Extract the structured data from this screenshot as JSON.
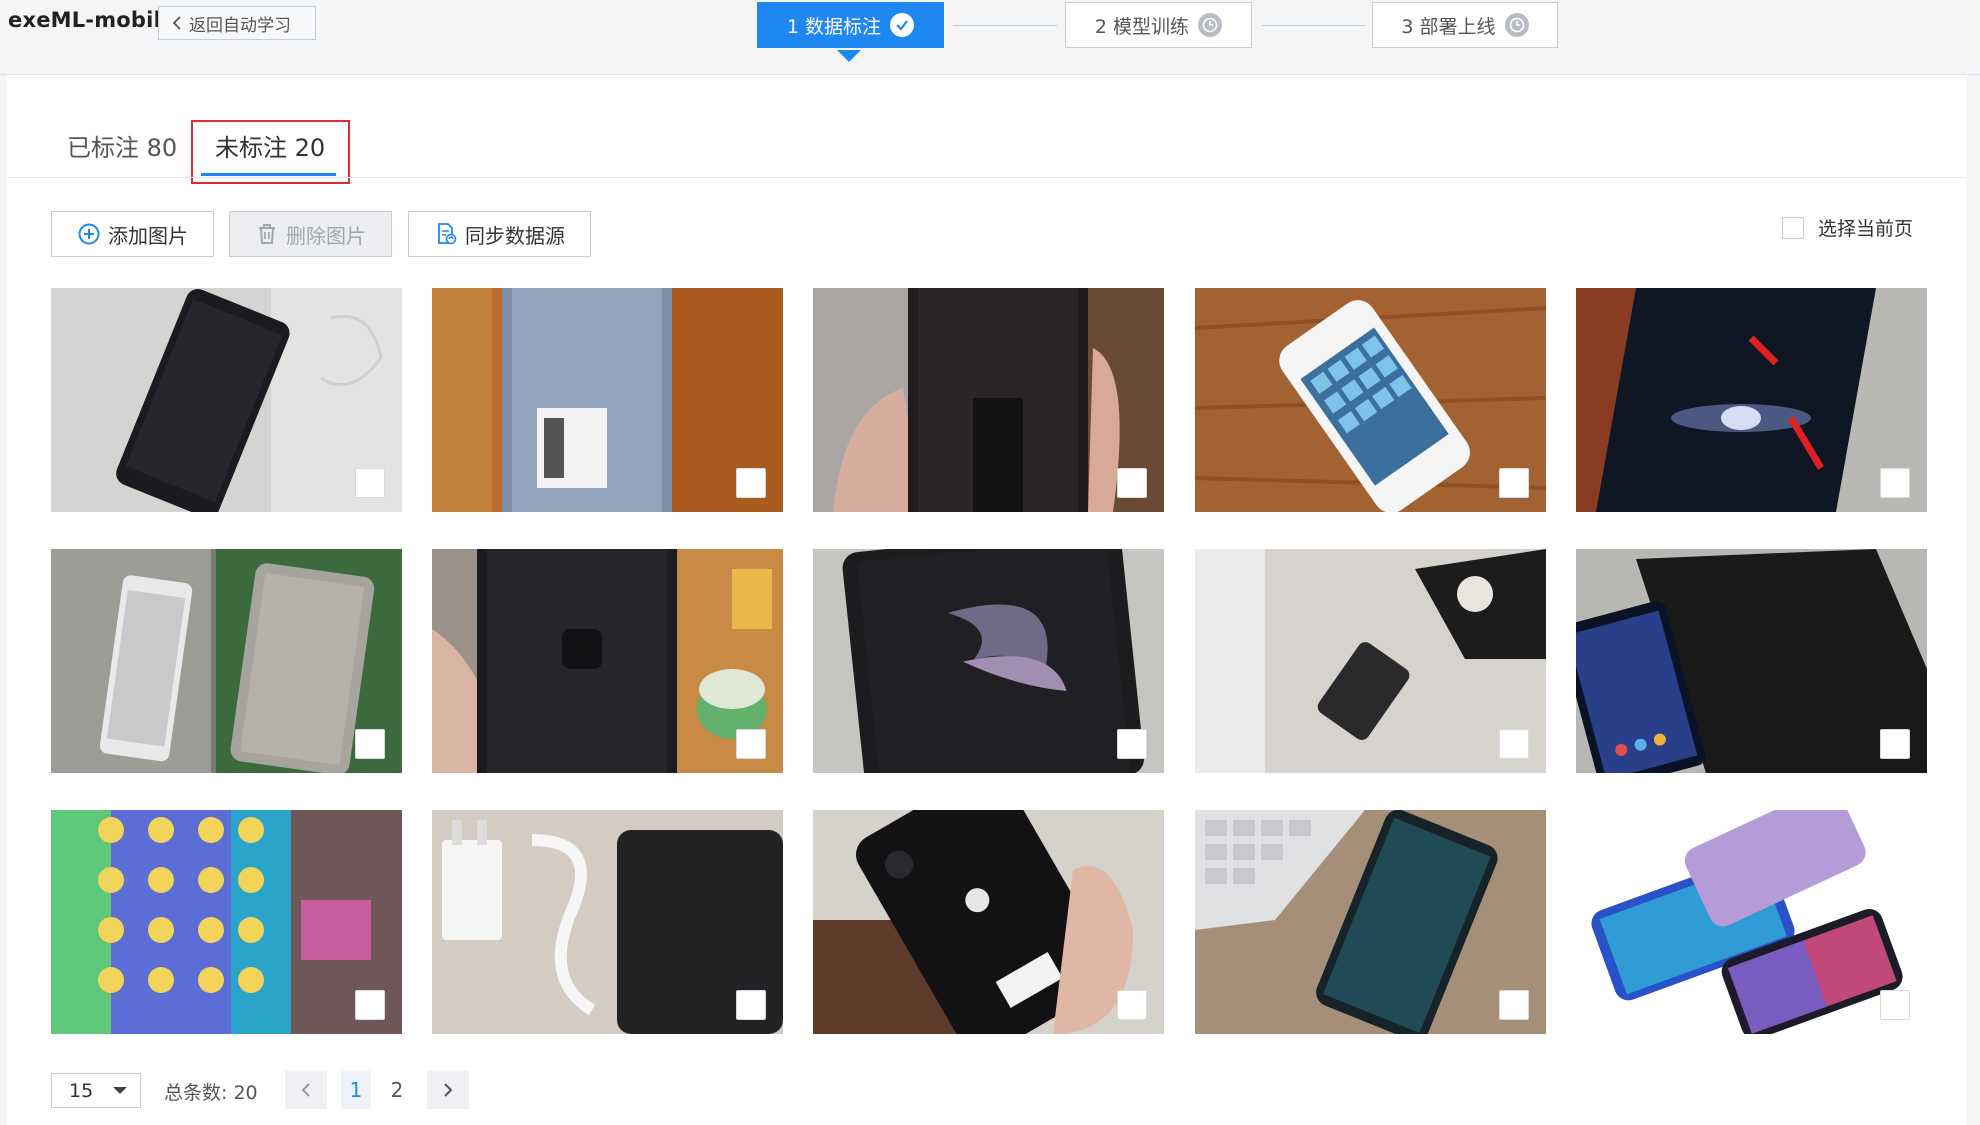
{
  "app": {
    "title": "exeML-mobil",
    "back_label": "返回自动学习"
  },
  "steps": [
    {
      "label": "1 数据标注",
      "state": "done"
    },
    {
      "label": "2 模型训练",
      "state": "pending"
    },
    {
      "label": "3 部署上线",
      "state": "pending"
    }
  ],
  "tabs": [
    {
      "label": "已标注 80"
    },
    {
      "label": "未标注 20"
    }
  ],
  "active_tab": 1,
  "toolbar": {
    "add_label": "添加图片",
    "delete_label": "删除图片",
    "sync_label": "同步数据源",
    "select_page_label": "选择当前页"
  },
  "images": [
    {
      "icon": "phone-photo-black-on-desk"
    },
    {
      "icon": "phone-photo-sticker-wood"
    },
    {
      "icon": "phone-photo-hand-holding"
    },
    {
      "icon": "phone-photo-iphone4-white"
    },
    {
      "icon": "phone-photo-dark-red-arrows"
    },
    {
      "icon": "phone-photo-gold-vivo"
    },
    {
      "icon": "phone-photo-hand-screen"
    },
    {
      "icon": "phone-photo-iphone-xr-wallpaper"
    },
    {
      "icon": "phone-photo-small-black-phone"
    },
    {
      "icon": "phone-photo-huawei-box"
    },
    {
      "icon": "phone-photo-colorful-homescreen"
    },
    {
      "icon": "phone-photo-charger-cable"
    },
    {
      "icon": "phone-photo-iphone-back"
    },
    {
      "icon": "phone-photo-keyboard-phone"
    },
    {
      "icon": "phone-photo-gradient-phones"
    }
  ],
  "pagination": {
    "page_size": "15",
    "total_label": "总条数: 20",
    "pages": [
      "1",
      "2"
    ],
    "current_page": "1"
  },
  "colors": {
    "accent": "#1e88f0",
    "highlight_box": "#e22d2d"
  }
}
